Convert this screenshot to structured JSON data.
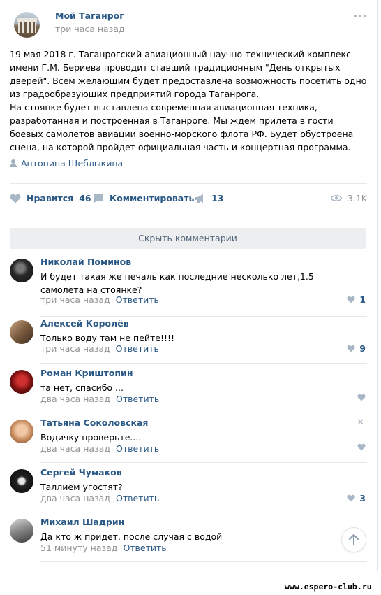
{
  "post": {
    "group_name": "Мой Таганрог",
    "time": "три часа назад",
    "text": [
      "19 мая 2018 г. Таганрогский авиационный научно-технический комплекс имени Г.М. Бериева проводит ставший традиционным \"День открытых дверей\". Всем желающим будет предоставлена возможность посетить одно из градообразующих предприятий города Таганрога.",
      "На стоянке будет выставлена современная авиационная техника, разработанная и построенная в Таганроге. Мы ждем прилета в гости боевых самолетов авиации военно-морского флота РФ. Будет обустроена сцена, на которой пройдет официальная часть и концертная программа."
    ],
    "signer": "Антонина Щеблыкина",
    "likes_label": "Нравится",
    "likes_count": "46",
    "comment_label": "Комментировать",
    "shares_count": "13",
    "views_count": "3.1K"
  },
  "comments_toggle_label": "Скрыть комментарии",
  "comments": [
    {
      "name": "Николай Поминов",
      "text": "И будет такая же печаль как последние несколько лет,1.5 самолета на стоянке?",
      "time": "три часа назад",
      "reply": "Ответить",
      "likes": "1",
      "avatar_color": "#3b3b3b"
    },
    {
      "name": "Алексей Королёв",
      "text": "Только воду там не пейте!!!!",
      "time": "три часа назад",
      "reply": "Ответить",
      "likes": "9",
      "avatar_color": "#8a6b52"
    },
    {
      "name": "Роман Криштопин",
      "text": "та нет, спасибо ...",
      "time": "два часа назад",
      "reply": "Ответить",
      "likes": "",
      "avatar_color": "#8e1a1a"
    },
    {
      "name": "Татьяна Соколовская",
      "text": "Водичку проверьте....",
      "time": "два часа назад",
      "reply": "Ответить",
      "likes": "",
      "avatar_color": "#d9a27b"
    },
    {
      "name": "Сергей Чумаков",
      "text": "Таллием угостят?",
      "time": "два часа назад",
      "reply": "Ответить",
      "likes": "3",
      "avatar_color": "#111111"
    },
    {
      "name": "Михаил Шадрин",
      "text": "Да кто ж придет, после случая с водой",
      "time": "51 минуту назад",
      "reply": "Ответить",
      "likes": "",
      "avatar_color": "#6b6b6b"
    }
  ],
  "watermark": "www.espero-club.ru",
  "colors": {
    "link": "#2a5885",
    "meta": "#939393",
    "icon": "#a8b6c6",
    "divider": "#e7e8ec"
  }
}
